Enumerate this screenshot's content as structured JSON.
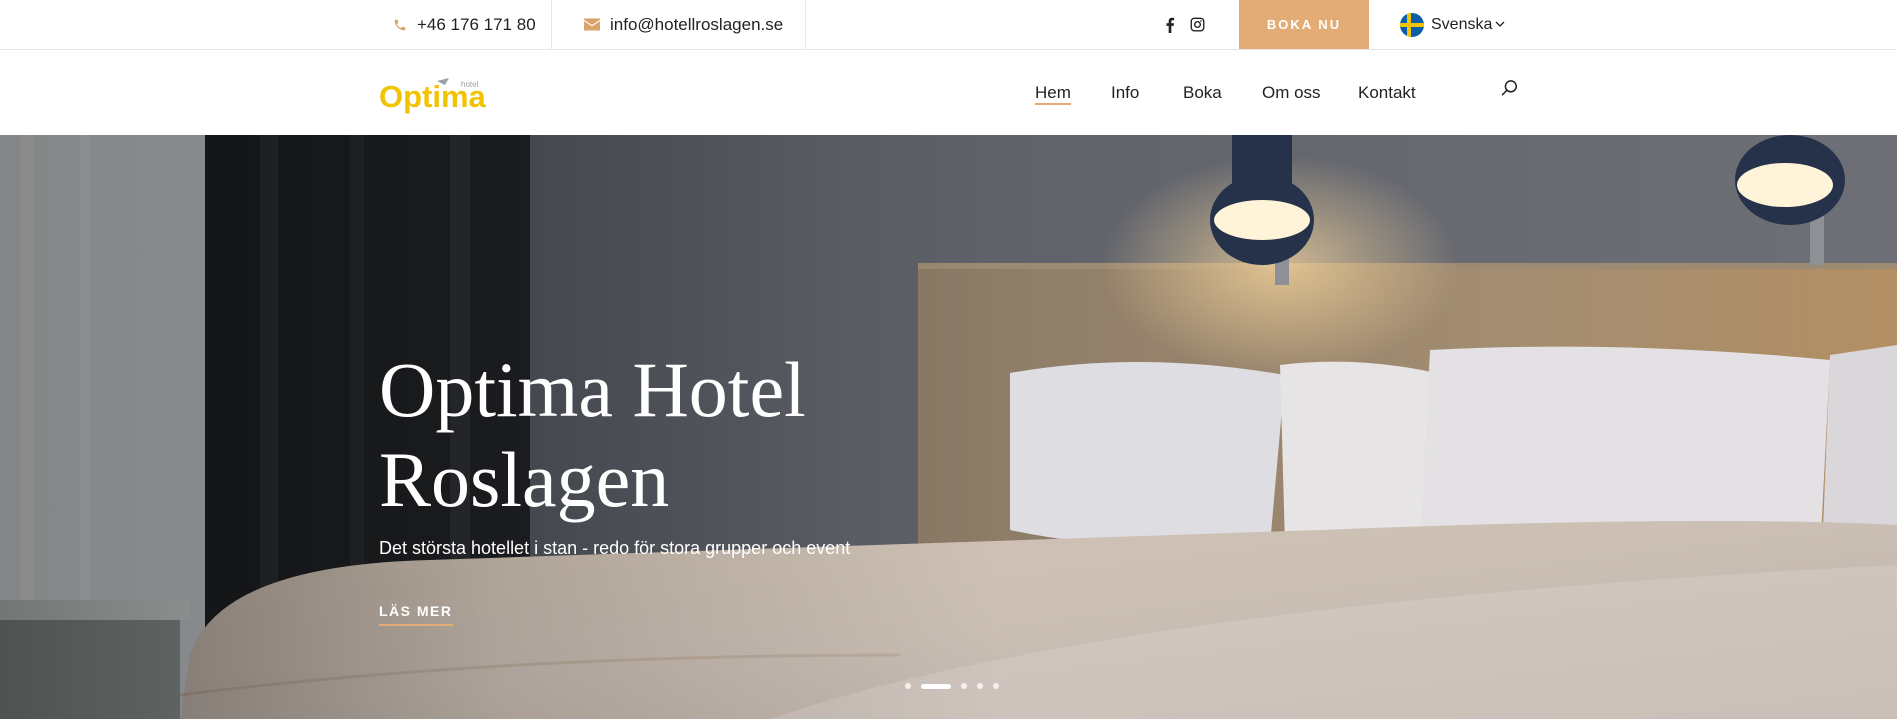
{
  "topbar": {
    "phone": "+46 176 171 80",
    "email": "info@hotellroslagen.se",
    "social": [
      "facebook-icon",
      "instagram-icon"
    ],
    "book_label": "BOKA NU",
    "language": "Svenska"
  },
  "brand": {
    "logo_text": "Optima",
    "logo_small": "hotel"
  },
  "nav": {
    "items": [
      {
        "label": "Hem",
        "active": true
      },
      {
        "label": "Info"
      },
      {
        "label": "Boka"
      },
      {
        "label": "Om oss"
      },
      {
        "label": "Kontakt"
      }
    ]
  },
  "hero": {
    "title": "Optima Hotel Roslagen",
    "subtitle": "Det största hotellet i stan - redo för stora grupper och event",
    "cta": "LÄS MER",
    "slides_count": 5,
    "active_slide": 2
  },
  "colors": {
    "accent": "#e3ac76",
    "logo": "#f2c300"
  }
}
